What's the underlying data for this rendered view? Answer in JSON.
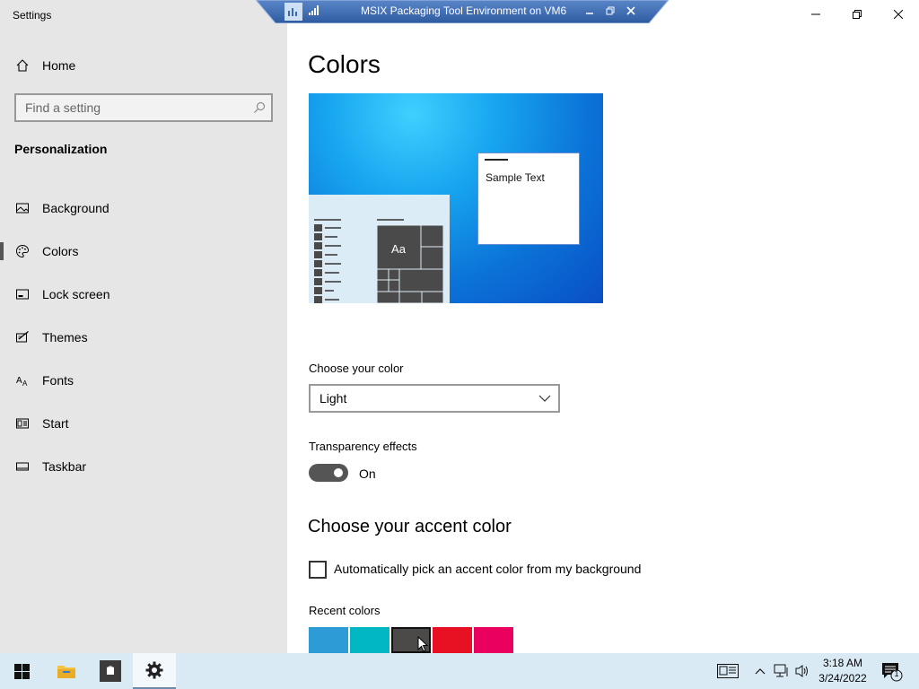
{
  "window": {
    "title": "Settings"
  },
  "remote_session": {
    "title": "MSIX Packaging Tool Environment on VM6"
  },
  "sidebar": {
    "home_label": "Home",
    "search_placeholder": "Find a setting",
    "section": "Personalization",
    "items": [
      {
        "label": "Background",
        "icon": "background-icon"
      },
      {
        "label": "Colors",
        "icon": "palette-icon",
        "active": true
      },
      {
        "label": "Lock screen",
        "icon": "lock-screen-icon"
      },
      {
        "label": "Themes",
        "icon": "themes-icon"
      },
      {
        "label": "Fonts",
        "icon": "fonts-icon"
      },
      {
        "label": "Start",
        "icon": "start-icon"
      },
      {
        "label": "Taskbar",
        "icon": "taskbar-icon"
      }
    ]
  },
  "main": {
    "title": "Colors",
    "preview": {
      "sample_text": "Sample Text",
      "tile_text": "Aa"
    },
    "choose_color": {
      "label": "Choose your color",
      "value": "Light"
    },
    "transparency": {
      "label": "Transparency effects",
      "state": "On"
    },
    "accent": {
      "title": "Choose your accent color",
      "auto_pick_label": "Automatically pick an accent color from my background",
      "recent_label": "Recent colors",
      "recent_colors": [
        "#2d9bd6",
        "#00b7c3",
        "#4c4a48",
        "#e81123",
        "#ea005e"
      ],
      "selected_index": 2
    }
  },
  "taskbar": {
    "time": "3:18 AM",
    "date": "3/24/2022",
    "notification_count": "1"
  }
}
